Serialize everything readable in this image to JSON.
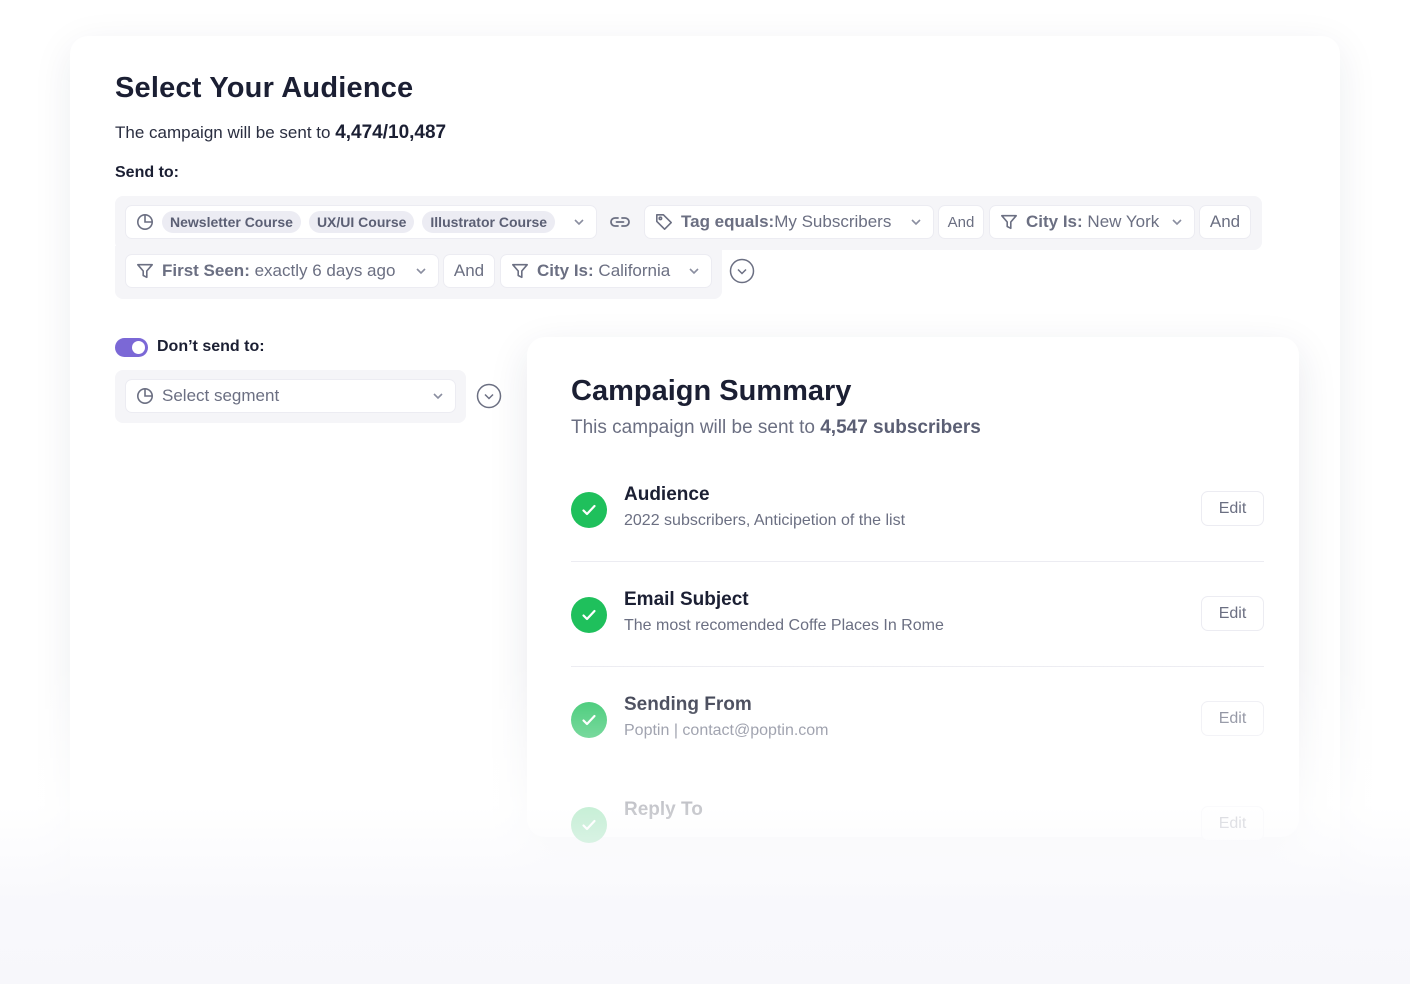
{
  "audience": {
    "title": "Select Your Audience",
    "sent_prefix": "The campaign will be sent to",
    "sent_count": "4,474/10,487",
    "send_to_label": "Send to:",
    "segments": [
      "Newsletter Course",
      "UX/UI Course",
      "Illustrator Course"
    ],
    "tag_filter": {
      "key": "Tag equals:",
      "value": "My Subscribers"
    },
    "and_labels": [
      "And",
      "And",
      "And"
    ],
    "city_filter_1": {
      "key": "City Is:",
      "value": "New York"
    },
    "first_seen_filter": {
      "key": "First Seen:",
      "value": "exactly 6 days ago"
    },
    "city_filter_2": {
      "key": "City Is:",
      "value": "California"
    },
    "dont_send_label": "Don’t send to:",
    "dont_send_enabled": true,
    "select_segment_placeholder": "Select segment"
  },
  "summary": {
    "title": "Campaign Summary",
    "sent_prefix": "This campaign will be sent to",
    "sent_count": "4,547 subscribers",
    "edit_label": "Edit",
    "rows": [
      {
        "title": "Audience",
        "desc": "2022 subscribers, Anticipetion of the list"
      },
      {
        "title": "Email Subject",
        "desc": "The most recomended Coffe Places In Rome"
      },
      {
        "title": "Sending From",
        "desc": "Poptin | contact@poptin.com"
      },
      {
        "title": "Reply To",
        "desc": ""
      }
    ]
  },
  "colors": {
    "toggle": "#7b68d6",
    "check": "#1fc05c"
  },
  "icons": [
    "segment-pie-icon",
    "chevron-down-icon",
    "link-icon",
    "tag-icon",
    "filter-icon",
    "circle-chevron-icon",
    "check-icon"
  ]
}
